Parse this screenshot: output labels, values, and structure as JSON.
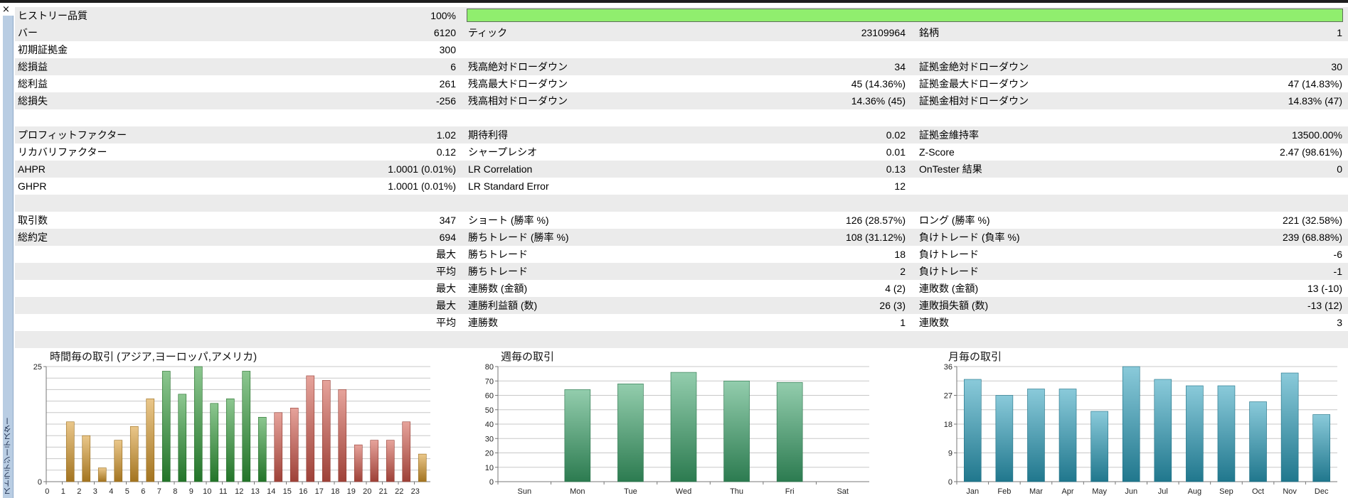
{
  "window": {
    "close_glyph": "×",
    "side_tab_label": "ストラテジーテスター"
  },
  "history_quality": {
    "label": "ヒストリー品質",
    "value": "100%",
    "fraction": 1.0
  },
  "rows": [
    {
      "shade": true,
      "quality": true,
      "c1l": "ヒストリー品質",
      "c1v": "100%"
    },
    {
      "shade": true,
      "c1l": "バー",
      "c1v": "6120",
      "c2l": "ティック",
      "c2v": "23109964",
      "c3l": "銘柄",
      "c3v": "1"
    },
    {
      "shade": false,
      "c1l": "初期証拠金",
      "c1v": "300"
    },
    {
      "shade": true,
      "c1l": "総損益",
      "c1v": "6",
      "c2l": "残高絶対ドローダウン",
      "c2v": "34",
      "c3l": "証拠金絶対ドローダウン",
      "c3v": "30"
    },
    {
      "shade": false,
      "c1l": "総利益",
      "c1v": "261",
      "c2l": "残高最大ドローダウン",
      "c2v": "45 (14.36%)",
      "c3l": "証拠金最大ドローダウン",
      "c3v": "47 (14.83%)"
    },
    {
      "shade": true,
      "c1l": "総損失",
      "c1v": "-256",
      "c2l": "残高相対ドローダウン",
      "c2v": "14.36% (45)",
      "c3l": "証拠金相対ドローダウン",
      "c3v": "14.83% (47)"
    },
    {
      "shade": false
    },
    {
      "shade": true,
      "c1l": "プロフィットファクター",
      "c1v": "1.02",
      "c2l": "期待利得",
      "c2v": "0.02",
      "c3l": "証拠金維持率",
      "c3v": "13500.00%"
    },
    {
      "shade": false,
      "c1l": "リカバリファクター",
      "c1v": "0.12",
      "c2l": "シャープレシオ",
      "c2v": "0.01",
      "c3l": "Z-Score",
      "c3v": "2.47 (98.61%)"
    },
    {
      "shade": true,
      "c1l": "AHPR",
      "c1v": "1.0001 (0.01%)",
      "c2l": "LR Correlation",
      "c2v": "0.13",
      "c3l": "OnTester 結果",
      "c3v": "0"
    },
    {
      "shade": false,
      "c1l": "GHPR",
      "c1v": "1.0001 (0.01%)",
      "c2l": "LR Standard Error",
      "c2v": "12"
    },
    {
      "shade": true
    },
    {
      "shade": false,
      "c1l": "取引数",
      "c1v": "347",
      "c2l": "ショート (勝率 %)",
      "c2v": "126 (28.57%)",
      "c3l": "ロング (勝率 %)",
      "c3v": "221 (32.58%)"
    },
    {
      "shade": true,
      "c1l": "総約定",
      "c1v": "694",
      "c2l": "勝ちトレード (勝率 %)",
      "c2v": "108 (31.12%)",
      "c3l": "負けトレード (負率 %)",
      "c3v": "239 (68.88%)"
    },
    {
      "shade": false,
      "c1v": "最大",
      "c2l": "勝ちトレード",
      "c2v": "18",
      "c3l": "負けトレード",
      "c3v": "-6"
    },
    {
      "shade": true,
      "c1v": "平均",
      "c2l": "勝ちトレード",
      "c2v": "2",
      "c3l": "負けトレード",
      "c3v": "-1"
    },
    {
      "shade": false,
      "c1v": "最大",
      "c2l": "連勝数 (金額)",
      "c2v": "4 (2)",
      "c3l": "連敗数 (金額)",
      "c3v": "13 (-10)"
    },
    {
      "shade": true,
      "c1v": "最大",
      "c2l": "連勝利益額 (数)",
      "c2v": "26 (3)",
      "c3l": "連敗損失額 (数)",
      "c3v": "-13 (12)"
    },
    {
      "shade": false,
      "c1v": "平均",
      "c2l": "連勝数",
      "c2v": "1",
      "c3l": "連敗数",
      "c3v": "3"
    },
    {
      "shade": true
    }
  ],
  "colors": {
    "quality_bar": "#90ee6e",
    "asia": "#d99a2a",
    "europe": "#2e9a36",
    "america": "#d2574a",
    "week": "#3aa46a",
    "month": "#2a9fbc"
  },
  "chart_data": [
    {
      "type": "bar",
      "title": "時間毎の取引 (アジア,ヨーロッパ,アメリカ)",
      "categories": [
        "0",
        "1",
        "2",
        "3",
        "4",
        "5",
        "6",
        "7",
        "8",
        "9",
        "10",
        "11",
        "12",
        "13",
        "14",
        "15",
        "16",
        "17",
        "18",
        "19",
        "20",
        "21",
        "22",
        "23"
      ],
      "values": [
        0,
        13,
        10,
        3,
        9,
        12,
        18,
        24,
        19,
        25,
        17,
        18,
        24,
        14,
        15,
        16,
        23,
        22,
        20,
        8,
        9,
        9,
        13,
        6
      ],
      "series_colors_by_index": [
        "asia",
        "asia",
        "asia",
        "asia",
        "asia",
        "asia",
        "asia",
        "europe",
        "europe",
        "europe",
        "europe",
        "europe",
        "europe",
        "europe",
        "america",
        "america",
        "america",
        "america",
        "america",
        "america",
        "america",
        "america",
        "america",
        "asia"
      ],
      "ylim": [
        0,
        25
      ],
      "yticks": [
        0,
        25
      ],
      "grid": true,
      "xlabel": "",
      "ylabel": ""
    },
    {
      "type": "bar",
      "title": "週毎の取引",
      "categories": [
        "Sun",
        "Mon",
        "Tue",
        "Wed",
        "Thu",
        "Fri",
        "Sat"
      ],
      "values": [
        0,
        64,
        68,
        76,
        70,
        69,
        0
      ],
      "ylim": [
        0,
        80
      ],
      "yticks": [
        0,
        10,
        20,
        30,
        40,
        50,
        60,
        70,
        80
      ],
      "grid": true,
      "xlabel": "",
      "ylabel": ""
    },
    {
      "type": "bar",
      "title": "月毎の取引",
      "categories": [
        "Jan",
        "Feb",
        "Mar",
        "Apr",
        "May",
        "Jun",
        "Jul",
        "Aug",
        "Sep",
        "Oct",
        "Nov",
        "Dec"
      ],
      "values": [
        32,
        27,
        29,
        29,
        22,
        36,
        32,
        30,
        30,
        25,
        34,
        21
      ],
      "ylim": [
        0,
        36
      ],
      "yticks": [
        0,
        9,
        18,
        27,
        36
      ],
      "grid": true,
      "xlabel": "",
      "ylabel": ""
    }
  ]
}
